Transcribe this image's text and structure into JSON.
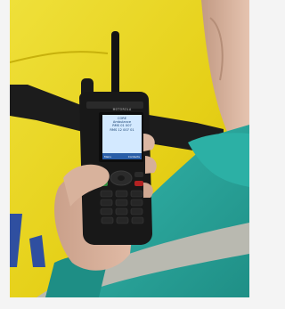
{
  "photo": {
    "description_tags": [
      "hand",
      "radio-handset",
      "yellow-vehicle",
      "teal-jacket"
    ],
    "colors": {
      "vehicle_yellow": "#e8d51e",
      "jacket_teal": "#2aa39a",
      "reflective_stripe": "#b9b9b0",
      "device_black": "#161616",
      "screen_blue": "#cfe6ff"
    }
  },
  "device": {
    "brand": "MOTOROLA",
    "screen_lines": [
      "CORE",
      "Ambulance",
      "RMS 01 007",
      "RMS 12 007 01"
    ],
    "softkeys": {
      "left": "Menu",
      "right": "Contacts"
    }
  }
}
